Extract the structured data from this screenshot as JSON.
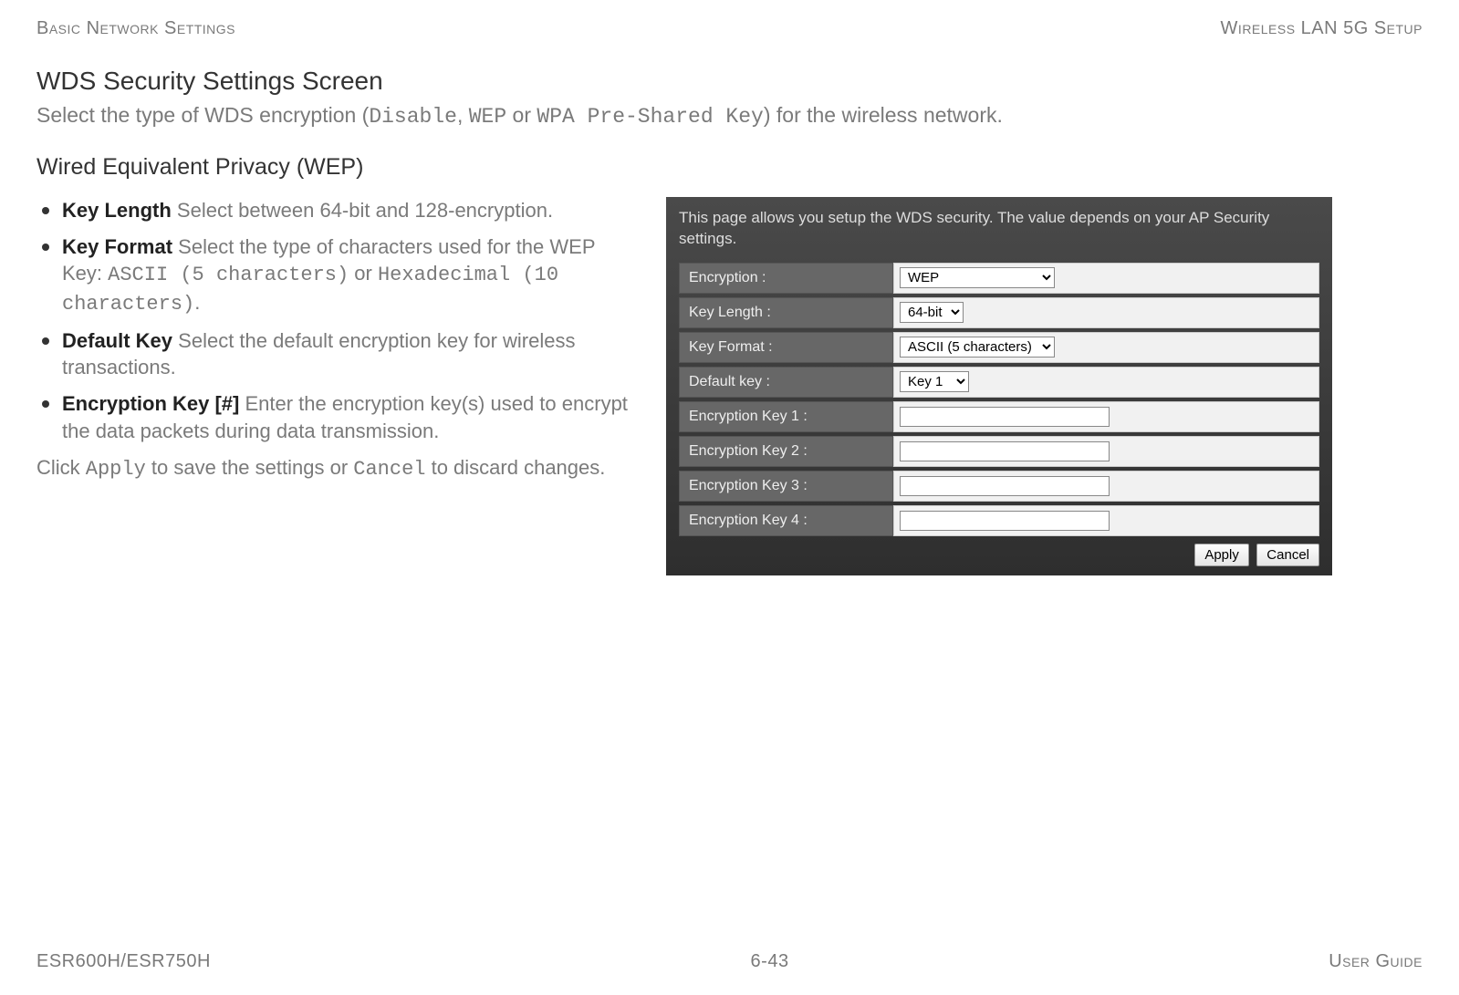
{
  "header": {
    "left": "Basic Network Settings",
    "right": "Wireless LAN 5G Setup"
  },
  "title": "WDS Security Settings Screen",
  "intro": {
    "p1": "Select the type of WDS encryption (",
    "c1": "Disable",
    "sep1": ", ",
    "c2": "WEP",
    "sep2": " or ",
    "c3": "WPA Pre-Shared Key",
    "p2": ") for the wireless network."
  },
  "subtitle": "Wired Equivalent Privacy (WEP)",
  "bullets": [
    {
      "term": "Key Length",
      "desc": "  Select between 64-bit and 128-encryption."
    },
    {
      "term": "Key Format",
      "desc_pre": "  Select the type of characters used for the WEP Key: ",
      "code1": "ASCII (5 characters)",
      "mid": " or ",
      "code2": "Hexadecimal (10 characters)",
      "suffix": "."
    },
    {
      "term": "Default Key",
      "desc": "  Select the default encryption key for wireless transactions."
    },
    {
      "term": "Encryption Key [#]",
      "desc": "  Enter the encryption key(s) used to encrypt the data packets during data transmission."
    }
  ],
  "closing": {
    "p1": "Click ",
    "c1": "Apply",
    "p2": " to save the settings or ",
    "c2": "Cancel",
    "p3": " to discard changes."
  },
  "screenshot": {
    "note": "This page allows you setup the WDS security. The value depends on your AP Security settings.",
    "rows": {
      "encryption": {
        "label": "Encryption :",
        "value": "WEP"
      },
      "keylength": {
        "label": "Key Length :",
        "value": "64-bit"
      },
      "keyformat": {
        "label": "Key Format :",
        "value": "ASCII (5 characters)"
      },
      "defaultkey": {
        "label": "Default key :",
        "value": "Key 1"
      },
      "k1": {
        "label": "Encryption Key 1 :",
        "value": ""
      },
      "k2": {
        "label": "Encryption Key 2 :",
        "value": ""
      },
      "k3": {
        "label": "Encryption Key 3 :",
        "value": ""
      },
      "k4": {
        "label": "Encryption Key 4 :",
        "value": ""
      }
    },
    "buttons": {
      "apply": "Apply",
      "cancel": "Cancel"
    }
  },
  "footer": {
    "left": "ESR600H/ESR750H",
    "center": "6-43",
    "right": "User Guide"
  }
}
